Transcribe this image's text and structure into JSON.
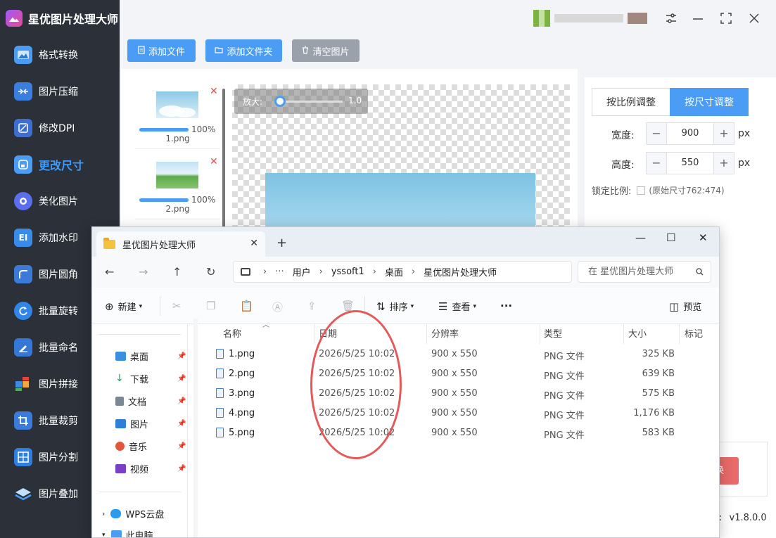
{
  "app": {
    "title": "星优图片处理大师",
    "version": "v1.8.0.0",
    "version_prefix": ":",
    "red_button_label": "换"
  },
  "sidebar": {
    "items": [
      {
        "label": "格式转换",
        "icon": "image-convert-icon"
      },
      {
        "label": "图片压缩",
        "icon": "compress-icon"
      },
      {
        "label": "修改DPI",
        "icon": "dpi-icon"
      },
      {
        "label": "更改尺寸",
        "icon": "resize-icon",
        "active": true
      },
      {
        "label": "美化图片",
        "icon": "beautify-icon"
      },
      {
        "label": "添加水印",
        "icon": "watermark-icon"
      },
      {
        "label": "图片圆角",
        "icon": "rounded-corner-icon"
      },
      {
        "label": "批量旋转",
        "icon": "rotate-icon"
      },
      {
        "label": "批量命名",
        "icon": "rename-icon"
      },
      {
        "label": "图片拼接",
        "icon": "stitch-icon"
      },
      {
        "label": "批量裁剪",
        "icon": "crop-icon"
      },
      {
        "label": "图片分割",
        "icon": "split-icon"
      },
      {
        "label": "图片叠加",
        "icon": "layers-icon"
      }
    ]
  },
  "toolbar": {
    "add_file": "添加文件",
    "add_folder": "添加文件夹",
    "clear": "清空图片"
  },
  "thumbs": [
    {
      "name": "1.png",
      "percent": "100%"
    },
    {
      "name": "2.png",
      "percent": "100%"
    }
  ],
  "preview": {
    "zoom_label": "放大:",
    "zoom_value": "1.0"
  },
  "right_panel": {
    "mode_ratio": "按比例调整",
    "mode_size": "按尺寸调整",
    "width_label": "宽度:",
    "width_value": "900",
    "height_label": "高度:",
    "height_value": "550",
    "unit": "px",
    "lock_label": "锁定比例:",
    "original_hint": "(原始尺寸762:474)",
    "minus": "−",
    "plus": "+"
  },
  "explorer": {
    "tab_title": "星优图片处理大师",
    "breadcrumb": [
      "用户",
      "yssoft1",
      "桌面",
      "星优图片处理大师"
    ],
    "search_placeholder": "在 星优图片处理大师",
    "commands": {
      "new": "新建",
      "sort": "排序",
      "view": "查看",
      "more": "···",
      "preview": "预览"
    },
    "nav_pane": [
      {
        "label": "桌面",
        "color": "#3b8fe0"
      },
      {
        "label": "下载",
        "color": "#1aa35b"
      },
      {
        "label": "文档",
        "color": "#7a8794"
      },
      {
        "label": "图片",
        "color": "#2f7fd8"
      },
      {
        "label": "音乐",
        "color": "#e2563b"
      },
      {
        "label": "视频",
        "color": "#7a3fc9"
      },
      {
        "label": "WPS云盘",
        "color": "#2b9bf0"
      },
      {
        "label": "此电脑",
        "color": "#4a9cf5"
      }
    ],
    "columns": [
      "名称",
      "日期",
      "分辨率",
      "类型",
      "大小",
      "标记"
    ],
    "files": [
      {
        "name": "1.png",
        "date": "2026/5/25 10:02",
        "resolution": "900 x 550",
        "type": "PNG 文件",
        "size": "325 KB"
      },
      {
        "name": "2.png",
        "date": "2026/5/25 10:02",
        "resolution": "900 x 550",
        "type": "PNG 文件",
        "size": "639 KB"
      },
      {
        "name": "3.png",
        "date": "2026/5/25 10:02",
        "resolution": "900 x 550",
        "type": "PNG 文件",
        "size": "575 KB"
      },
      {
        "name": "4.png",
        "date": "2026/5/25 10:02",
        "resolution": "900 x 550",
        "type": "PNG 文件",
        "size": "1,176 KB"
      },
      {
        "name": "5.png",
        "date": "2026/5/25 10:02",
        "resolution": "900 x 550",
        "type": "PNG 文件",
        "size": "583 KB"
      }
    ]
  }
}
